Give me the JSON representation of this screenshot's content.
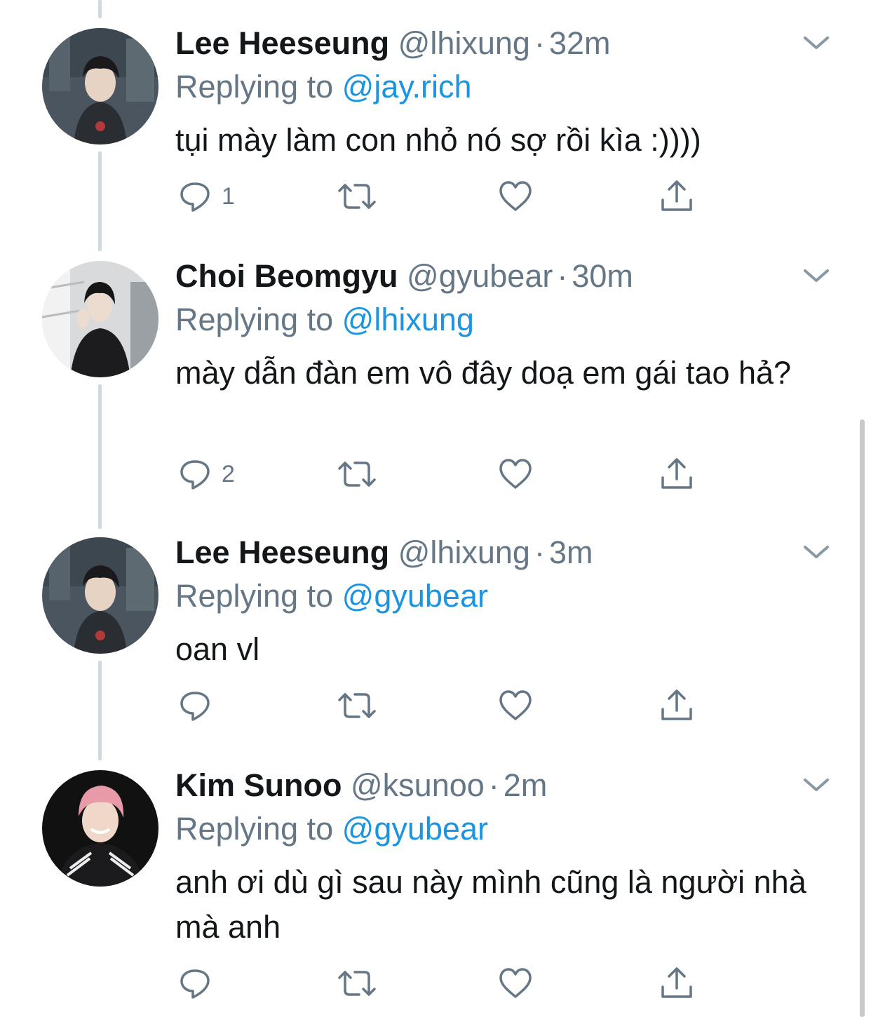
{
  "colors": {
    "text": "#14171a",
    "secondary": "#657786",
    "link": "#1b95e0",
    "thread_line": "#cfd9de"
  },
  "icons": {
    "reply": "reply-icon",
    "retweet": "retweet-icon",
    "like": "heart-icon",
    "share": "share-icon",
    "more": "chevron-down-icon"
  },
  "tweets": [
    {
      "display_name": "Lee Heeseung",
      "handle": "@lhixung",
      "separator": "·",
      "time": "32m",
      "replying_label": "Replying to",
      "replying_to": "@jay.rich",
      "text": "tụi mày làm con nhỏ nó sợ rồi kìa :))))",
      "reply_count": "1"
    },
    {
      "display_name": "Choi Beomgyu",
      "handle": "@gyubear",
      "separator": "·",
      "time": "30m",
      "replying_label": "Replying to",
      "replying_to": "@lhixung",
      "text": "mày dẫn đàn em vô đây doạ em gái tao hả?",
      "reply_count": "2"
    },
    {
      "display_name": "Lee Heeseung",
      "handle": "@lhixung",
      "separator": "·",
      "time": "3m",
      "replying_label": "Replying to",
      "replying_to": "@gyubear",
      "text": "oan vl",
      "reply_count": ""
    },
    {
      "display_name": "Kim Sunoo",
      "handle": "@ksunoo",
      "separator": "·",
      "time": "2m",
      "replying_label": "Replying to",
      "replying_to": "@gyubear",
      "text": "anh ơi dù gì sau này mình cũng là người nhà mà anh",
      "reply_count": ""
    }
  ]
}
